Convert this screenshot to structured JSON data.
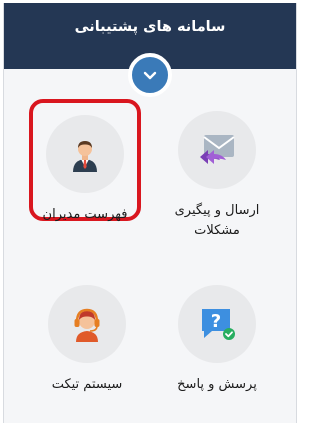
{
  "header": {
    "title": "سامانه های پشتیبانی"
  },
  "toggle": {
    "icon": "chevron-down-icon"
  },
  "cards": {
    "managers": {
      "label": "فهرست مدیران",
      "icon": "manager-avatar-icon",
      "selected": true
    },
    "issues": {
      "label": "ارسال و پیگیری مشکلات",
      "icon": "mail-reply-icon"
    },
    "faq": {
      "label": "پرسش و پاسخ",
      "icon": "question-chat-icon"
    },
    "ticket": {
      "label": "سیستم تیکت",
      "icon": "support-agent-icon"
    }
  },
  "colors": {
    "header_bg": "#243754",
    "toggle_bg": "#3a7ab8",
    "highlight_border": "#d9161f"
  }
}
